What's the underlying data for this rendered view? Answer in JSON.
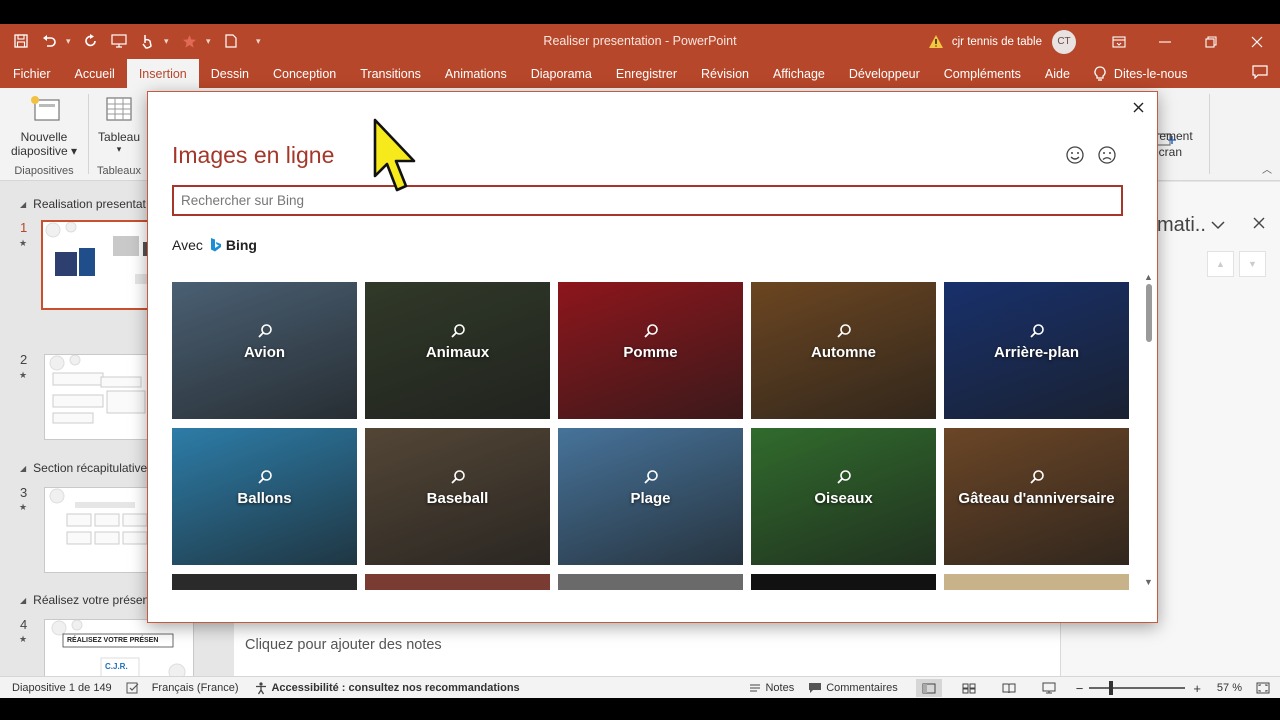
{
  "window": {
    "doc_title": "Realiser presentation  -  PowerPoint",
    "user_name": "cjr tennis de table",
    "user_initials": "CT"
  },
  "ribbon": {
    "tabs": [
      {
        "label": "Fichier",
        "active": false
      },
      {
        "label": "Accueil",
        "active": false
      },
      {
        "label": "Insertion",
        "active": true
      },
      {
        "label": "Dessin",
        "active": false
      },
      {
        "label": "Conception",
        "active": false
      },
      {
        "label": "Transitions",
        "active": false
      },
      {
        "label": "Animations",
        "active": false
      },
      {
        "label": "Diaporama",
        "active": false
      },
      {
        "label": "Enregistrer",
        "active": false
      },
      {
        "label": "Révision",
        "active": false
      },
      {
        "label": "Affichage",
        "active": false
      },
      {
        "label": "Développeur",
        "active": false
      },
      {
        "label": "Compléments",
        "active": false
      },
      {
        "label": "Aide",
        "active": false
      }
    ],
    "tell_me": "Dites-le-nous",
    "new_slide_line1": "Nouvelle",
    "new_slide_line2": "diapositive",
    "group_slides": "Diapositives",
    "table_label": "Tableau",
    "group_tables": "Tableaux",
    "partial_line1": "trement",
    "partial_line2": "écran"
  },
  "slides_panel": {
    "sections": [
      {
        "name": "Realisation presentat"
      },
      {
        "name": "Section récapitulative"
      },
      {
        "name": "Réalisez votre présen"
      }
    ],
    "slides": [
      {
        "number": "1"
      },
      {
        "number": "2"
      },
      {
        "number": "3"
      },
      {
        "number": "4"
      }
    ],
    "slide4_banner": "RÉALISEZ VOTRE PRÉSEN",
    "slide4_logo": "C.J.R."
  },
  "editor": {
    "notes_placeholder": "Cliquez pour ajouter des notes"
  },
  "task_pane": {
    "title": "mati.."
  },
  "dialog": {
    "title": "Images en ligne",
    "search_placeholder": "Rechercher sur Bing",
    "provider_prefix": "Avec",
    "provider_name": "Bing",
    "categories": [
      {
        "label": "Avion",
        "color": "#5f7b94"
      },
      {
        "label": "Animaux",
        "color": "#3f4a35"
      },
      {
        "label": "Pomme",
        "color": "#b51d24"
      },
      {
        "label": "Automne",
        "color": "#8a5a2b"
      },
      {
        "label": "Arrière-plan",
        "color": "#1f3f8a"
      },
      {
        "label": "Ballons",
        "color": "#3aa0d8"
      },
      {
        "label": "Baseball",
        "color": "#6b5a46"
      },
      {
        "label": "Plage",
        "color": "#5b94c6"
      },
      {
        "label": "Oiseaux",
        "color": "#3f8a3a"
      },
      {
        "label": "Gâteau d'anniversaire",
        "color": "#8a5a32"
      }
    ]
  },
  "statusbar": {
    "slide_info": "Diapositive 1 de 149",
    "language": "Français (France)",
    "accessibility": "Accessibilité : consultez nos recommandations",
    "notes": "Notes",
    "comments": "Commentaires",
    "zoom": "57 %",
    "zoom_level": 0.57
  }
}
